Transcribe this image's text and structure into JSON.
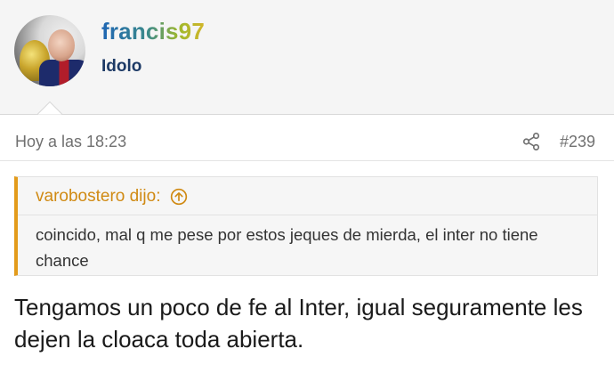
{
  "user": {
    "username": "francis97",
    "title": "Idolo"
  },
  "post": {
    "date": "Hoy a las 18:23",
    "number": "#239",
    "quote": {
      "author": "varobostero dijo:",
      "text": "coincido, mal q me pese por estos jeques de mierda, el inter no tiene chance"
    },
    "body": "Tengamos un poco de fe al Inter, igual seguramente les dejen la cloaca toda abierta."
  },
  "icons": {
    "share": "share-icon",
    "quote_jump": "arrow-up-circle-icon"
  },
  "colors": {
    "quote_accent": "#e39b1b",
    "user_title": "#1d3a66"
  }
}
